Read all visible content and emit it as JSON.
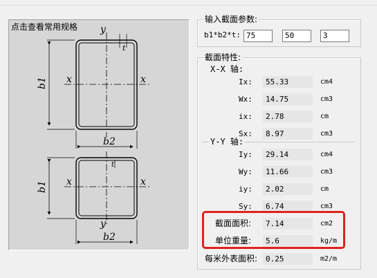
{
  "diagram_panel": {
    "title": "点击查看常用规格",
    "top": {
      "y": "y",
      "x_left": "x",
      "x_right": "x",
      "t": "t",
      "b1": "b1",
      "b2": "b2"
    },
    "bottom": {
      "y": "y",
      "x_left": "x",
      "x_right": "x",
      "t": "t",
      "b1": "b1",
      "b2": "b2"
    }
  },
  "input_group": {
    "title": "输入截面参数:",
    "label": "b1*b2*t:",
    "b1": "75",
    "b2": "50",
    "t": "3"
  },
  "properties_group": {
    "title": "截面特性:",
    "xx_title": "X-X 轴:",
    "xx_rows": [
      {
        "label": "Ix:",
        "value": "55.33",
        "unit": "cm4"
      },
      {
        "label": "Wx:",
        "value": "14.75",
        "unit": "cm3"
      },
      {
        "label": "ix:",
        "value": "2.78",
        "unit": "cm"
      },
      {
        "label": "Sx:",
        "value": "8.97",
        "unit": "cm3"
      }
    ],
    "yy_title": "Y-Y 轴:",
    "yy_rows": [
      {
        "label": "Iy:",
        "value": "29.14",
        "unit": "cm4"
      },
      {
        "label": "Wy:",
        "value": "11.66",
        "unit": "cm3"
      },
      {
        "label": "iy:",
        "value": "2.02",
        "unit": "cm"
      },
      {
        "label": "Sy:",
        "value": "6.74",
        "unit": "cm3"
      }
    ],
    "area": {
      "label": "截面面积:",
      "value": "7.14",
      "unit": "cm2"
    },
    "weight": {
      "label": "单位重量:",
      "value": "5.6",
      "unit": "kg/m"
    },
    "surface": {
      "label": "每米外表面积:",
      "value": "0.25",
      "unit": "m2/m"
    }
  },
  "colors": {
    "highlight": "#e0211d",
    "panel": "#d6d6d6",
    "field": "#e6e6e6"
  }
}
